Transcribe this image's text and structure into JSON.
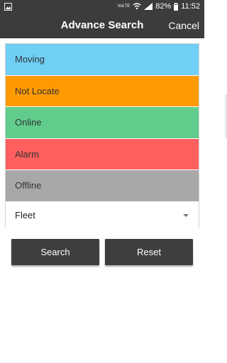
{
  "status_bar": {
    "network_label": "VoLTE",
    "battery": "82%",
    "time": "11:52"
  },
  "app_bar": {
    "title": "Advance Search",
    "cancel_label": "Cancel"
  },
  "filters": [
    {
      "label": "Moving",
      "color": "#6fcff4"
    },
    {
      "label": "Not Locate",
      "color": "#ff9a00"
    },
    {
      "label": "Online",
      "color": "#62cc8c"
    },
    {
      "label": "Alarm",
      "color": "#ff5f5f"
    },
    {
      "label": "Offline",
      "color": "#a8a8a8"
    }
  ],
  "fleet_select": {
    "selected": "Fleet"
  },
  "actions": {
    "search_label": "Search",
    "reset_label": "Reset"
  }
}
